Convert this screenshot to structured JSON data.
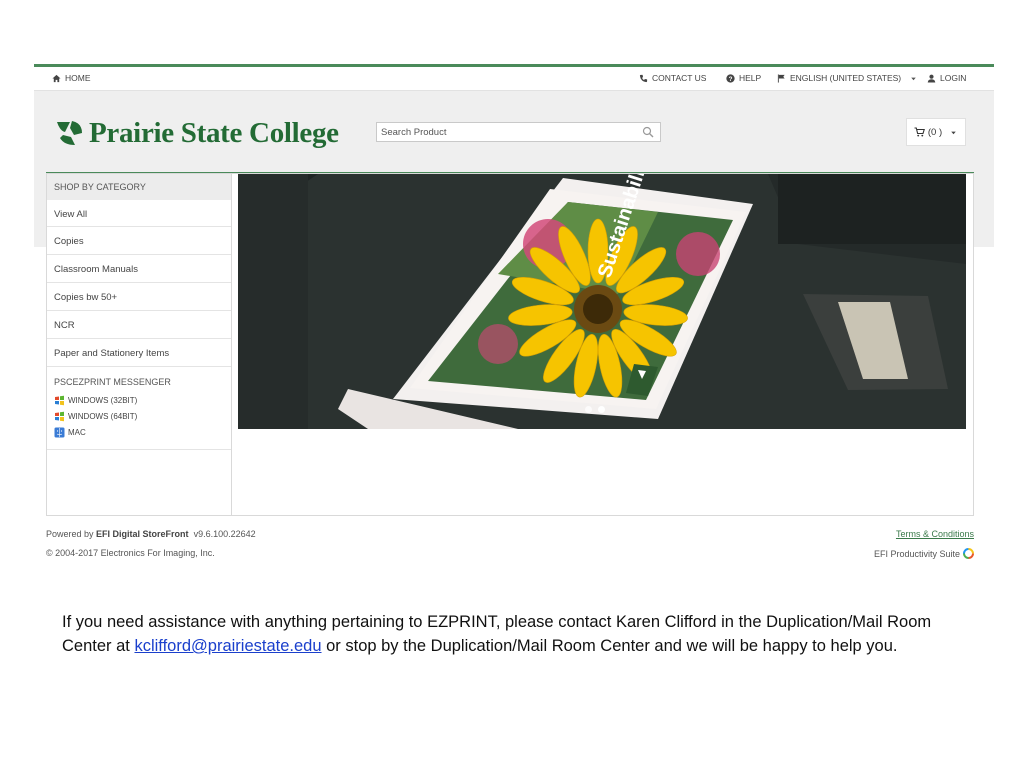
{
  "nav": {
    "home": "HOME",
    "contact": "CONTACT US",
    "help": "HELP",
    "language": "ENGLISH (UNITED STATES)",
    "login": "LOGIN"
  },
  "brand": {
    "name": "Prairie State College",
    "color": "#236b35"
  },
  "search": {
    "placeholder": "Search Product"
  },
  "cart": {
    "label": "(0 )"
  },
  "sidebar": {
    "heading": "SHOP BY CATEGORY",
    "items": [
      {
        "label": "View All"
      },
      {
        "label": "Copies"
      },
      {
        "label": "Classroom Manuals"
      },
      {
        "label": "Copies bw 50+"
      },
      {
        "label": "NCR"
      },
      {
        "label": "Paper and Stationery Items"
      }
    ],
    "messenger": {
      "heading": "PSCEZPRINT MESSENGER",
      "downloads": [
        {
          "label": "WINDOWS (32BIT)",
          "icon": "windows-icon"
        },
        {
          "label": "WINDOWS (64BIT)",
          "icon": "windows-icon"
        },
        {
          "label": "MAC",
          "icon": "mac-icon"
        }
      ]
    }
  },
  "hero": {
    "cover_title": "Sustainability",
    "slides": 2,
    "active_slide": 1
  },
  "footer": {
    "powered_prefix": "Powered by ",
    "powered_brand": "EFI Digital StoreFront",
    "version": "v9.6.100.22642",
    "copyright": "© 2004-2017 Electronics For Imaging, Inc.",
    "terms": "Terms & Conditions",
    "suite": "EFI Productivity Suite"
  },
  "note": {
    "before": "If you need assistance with anything pertaining to EZPRINT, please contact Karen Clifford in the Duplication/Mail Room Center at ",
    "email": "kclifford@prairiestate.edu",
    "after": " or stop by the Duplication/Mail Room Center and we will be happy to help you."
  },
  "colors": {
    "accent": "#4a8a5a",
    "link": "#1a3fcc"
  }
}
